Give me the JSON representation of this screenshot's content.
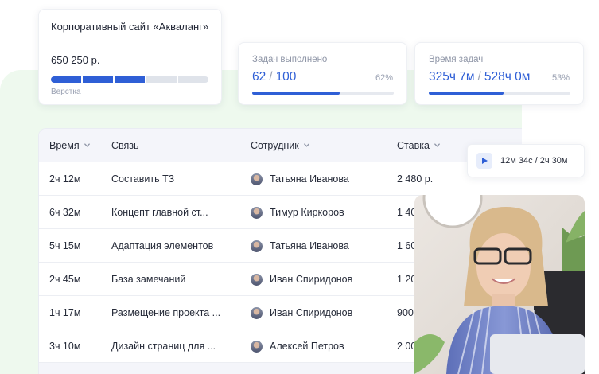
{
  "project": {
    "title": "Корпоративный сайт «Акваланг»",
    "price": "650 250 р.",
    "stage": "Верстка",
    "progress_segments_total": 5,
    "progress_segments_done": 3
  },
  "stats": [
    {
      "label": "Задач выполнено",
      "value_a": "62",
      "separator": "/",
      "value_b": "100",
      "percent": "62%",
      "fraction": 0.62
    },
    {
      "label": "Время задач",
      "value_a": "325ч 7м",
      "separator": "/",
      "value_b": "528ч 0м",
      "percent": "53%",
      "fraction": 0.53
    }
  ],
  "timer": {
    "text": "12м 34с / 2ч 30м",
    "icon": "play-icon"
  },
  "table": {
    "headers": {
      "time": "Время",
      "task": "Связь",
      "employee": "Сотрудник",
      "rate": "Ставка"
    },
    "rows": [
      {
        "time": "2ч 12м",
        "task": "Составить ТЗ",
        "employee": "Татьяна Иванова",
        "rate": "2 480 р."
      },
      {
        "time": "6ч 32м",
        "task": "Концепт главной ст...",
        "employee": "Тимур Киркоров",
        "rate": "1 40"
      },
      {
        "time": "5ч 15м",
        "task": "Адаптация элементов",
        "employee": "Татьяна Иванова",
        "rate": "1 60"
      },
      {
        "time": "2ч 45м",
        "task": "База замечаний",
        "employee": "Иван Спиридонов",
        "rate": "1 20"
      },
      {
        "time": "1ч 17м",
        "task": "Размещение проекта ...",
        "employee": "Иван Спиридонов",
        "rate": "900"
      },
      {
        "time": "3ч 10м",
        "task": "Дизайн страниц для ...",
        "employee": "Алексей Петров",
        "rate": "2 00"
      }
    ]
  },
  "colors": {
    "accent": "#2f5fd6",
    "bg_green": "#eef9ee",
    "muted": "#9aa1b2"
  }
}
